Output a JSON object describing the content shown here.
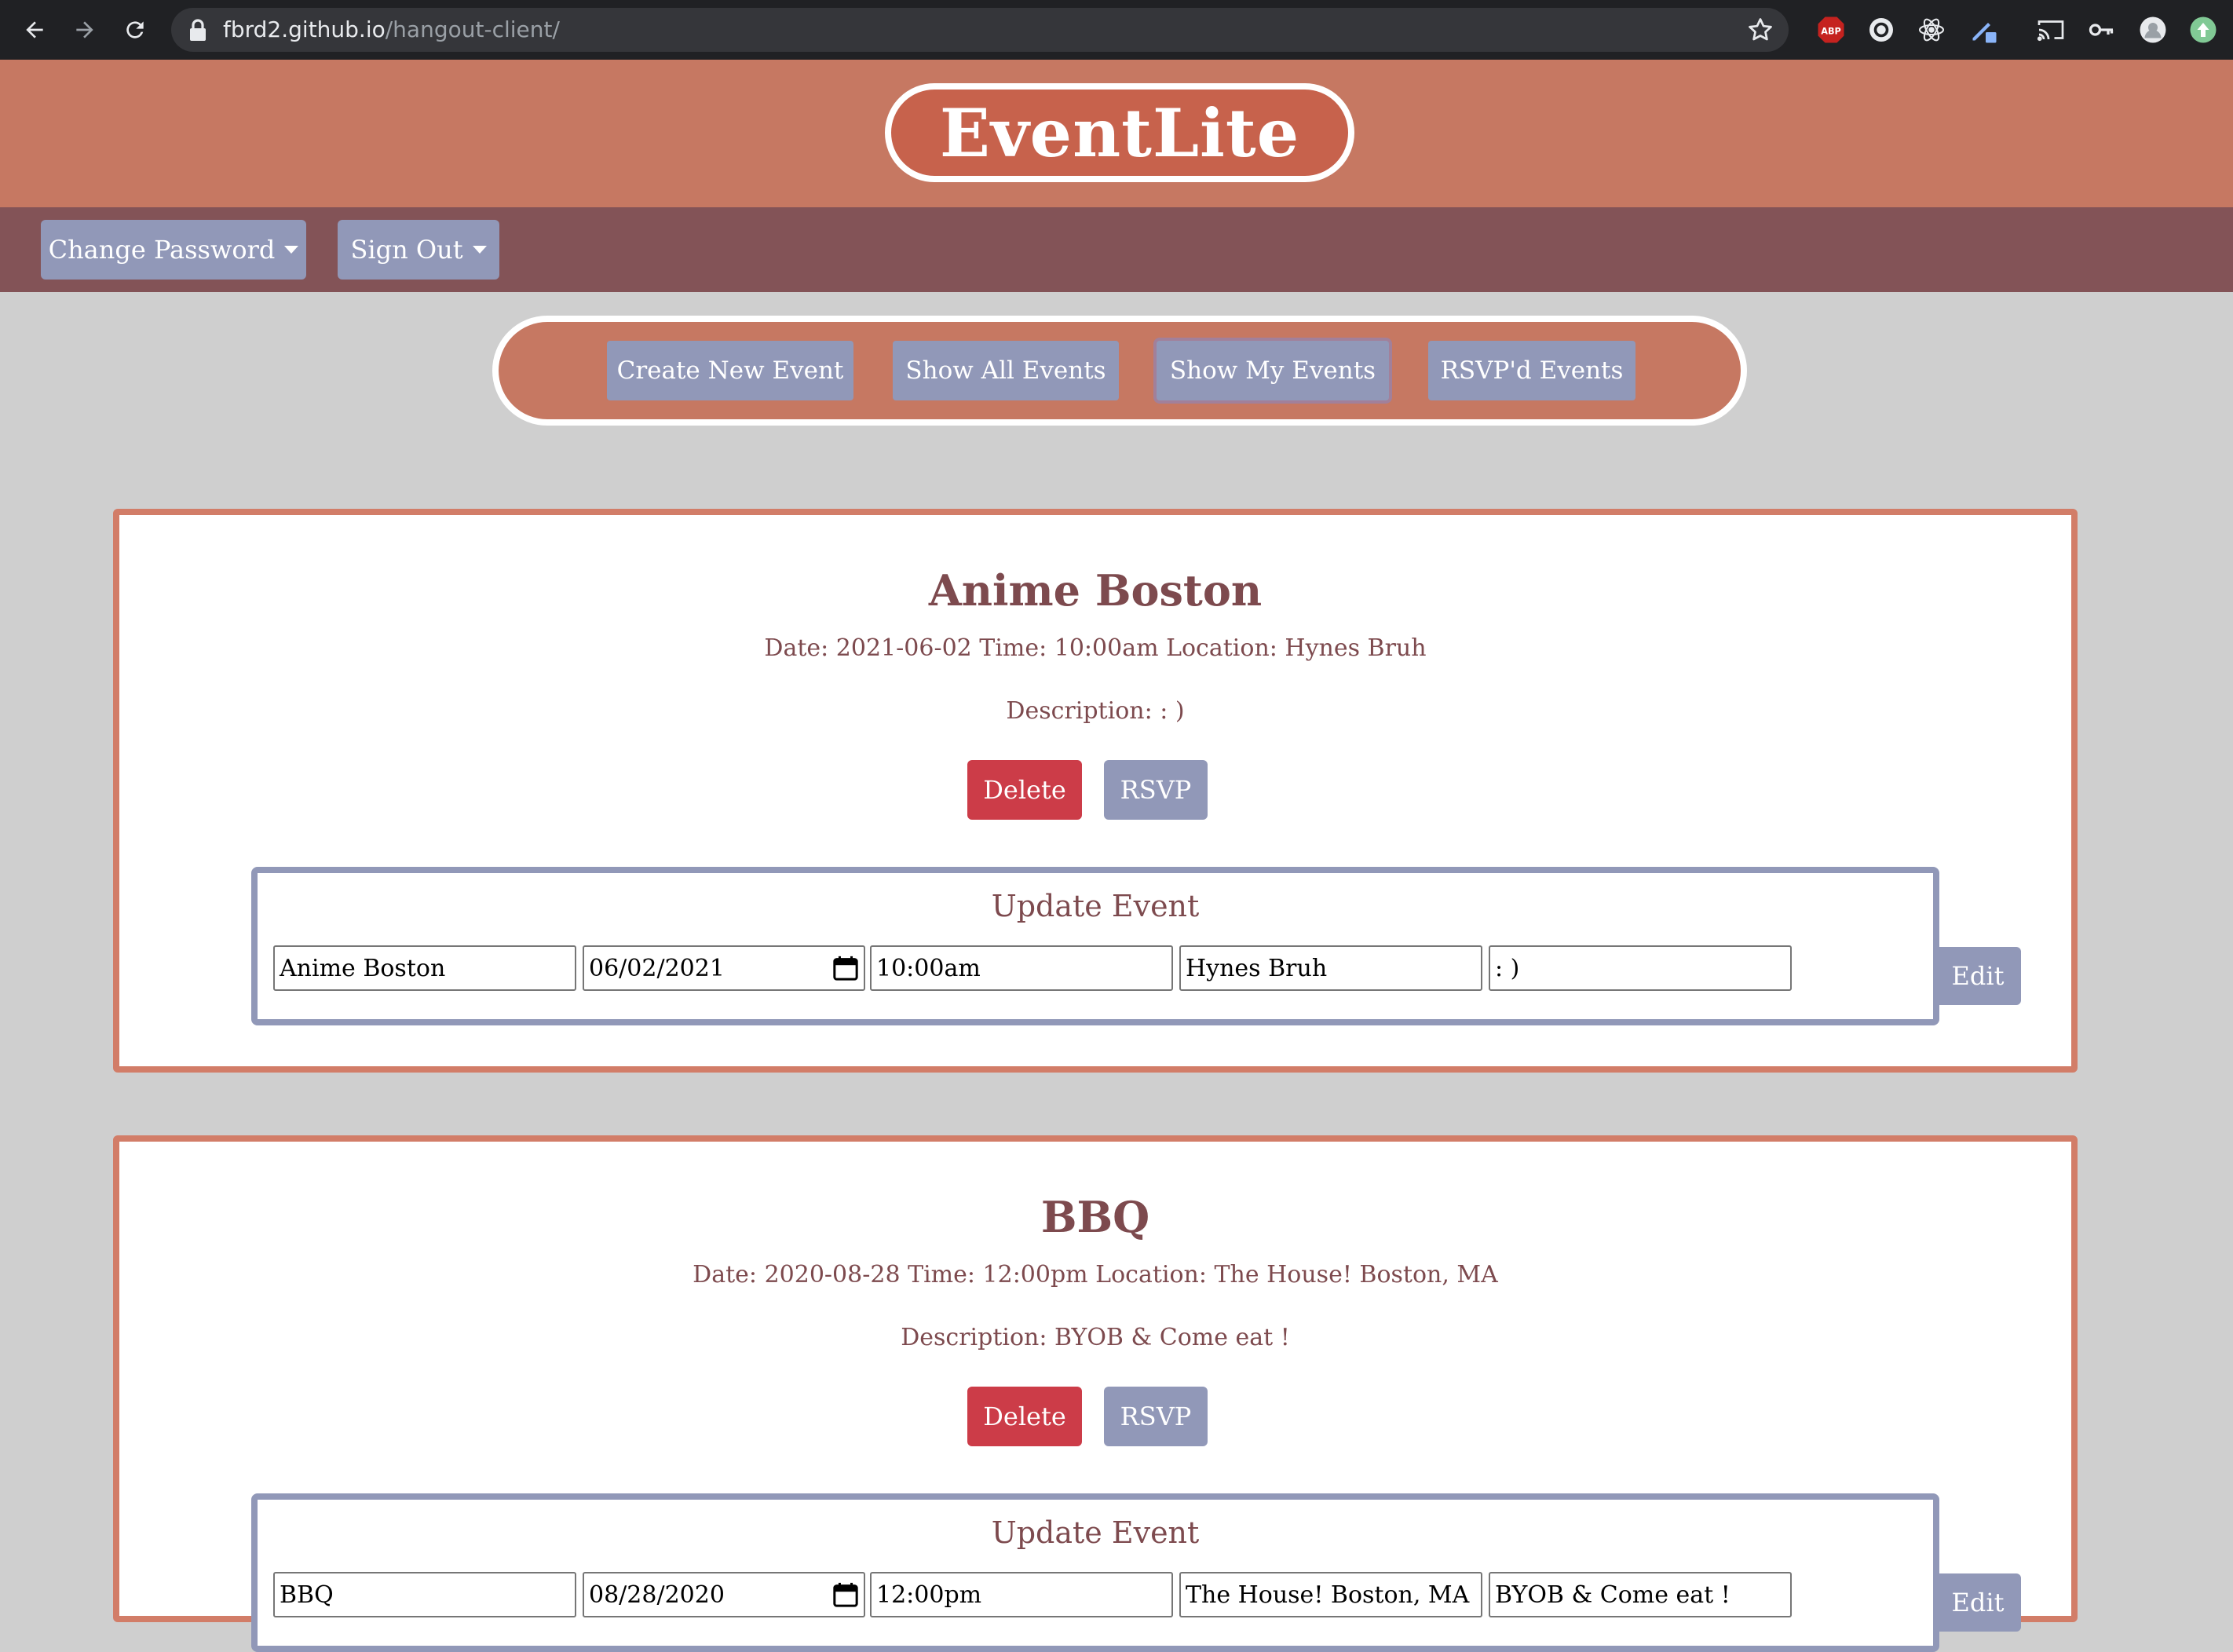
{
  "browser": {
    "url_host": "fbrd2.github.io",
    "url_path": "/hangout-client/",
    "extensions": [
      "abp-icon",
      "grammar-icon",
      "react-devtools-icon",
      "pen-icon",
      "cast-icon",
      "key-icon",
      "profile-avatar",
      "update-icon"
    ],
    "abp_label": "ABP"
  },
  "header": {
    "logo": "EventLite"
  },
  "account": {
    "change_password": "Change Password",
    "sign_out": "Sign Out"
  },
  "nav": {
    "create": "Create New Event",
    "show_all": "Show All Events",
    "show_mine": "Show My Events",
    "rsvpd": "RSVP'd Events",
    "active": "Show My Events"
  },
  "events": [
    {
      "title": "Anime Boston",
      "meta": "Date: 2021-06-02 Time: 10:00am Location: Hynes Bruh",
      "description": "Description: : )",
      "delete_label": "Delete",
      "rsvp_label": "RSVP",
      "update": {
        "title": "Update Event",
        "name": "Anime Boston",
        "date": "06/02/2021",
        "time": "10:00am",
        "location": "Hynes Bruh",
        "description": ": )",
        "edit_label": "Edit"
      }
    },
    {
      "title": "BBQ",
      "meta": "Date: 2020-08-28 Time: 12:00pm Location: The House! Boston, MA",
      "description": "Description: BYOB & Come eat !",
      "delete_label": "Delete",
      "rsvp_label": "RSVP",
      "update": {
        "title": "Update Event",
        "name": "BBQ",
        "date": "08/28/2020",
        "time": "12:00pm",
        "location": "The House! Boston, MA",
        "description": "BYOB & Come eat !",
        "edit_label": "Edit"
      }
    }
  ],
  "colors": {
    "header": "#c67862",
    "account_bar": "#835357",
    "button": "#9198b8",
    "delete": "#cc3c48",
    "card_border": "#d27d68",
    "text": "#7d4a4e"
  }
}
